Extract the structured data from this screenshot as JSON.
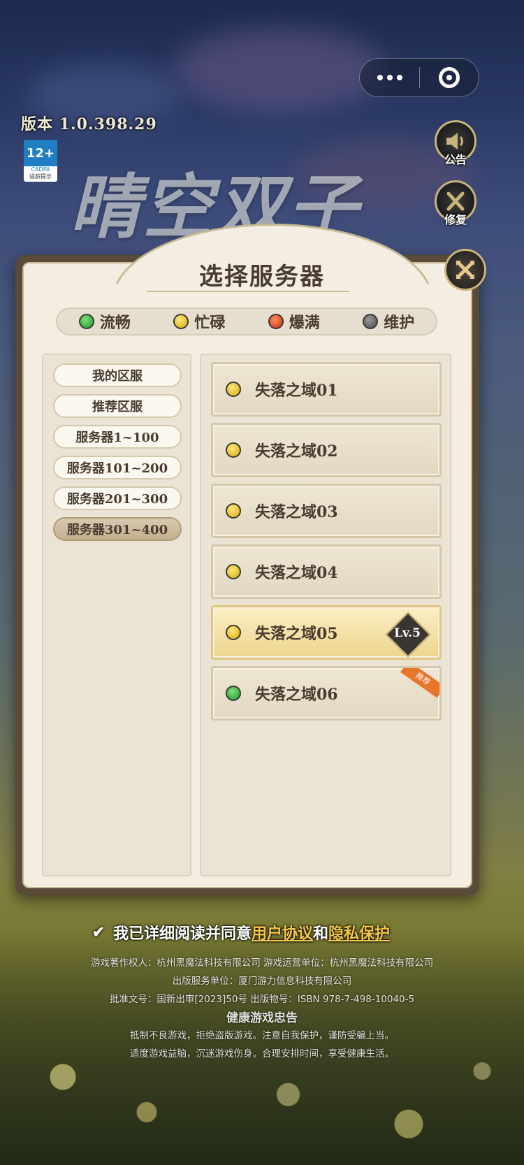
{
  "header": {
    "version_label": "版本 1.0.398.29",
    "age_rating": {
      "badge": "12+",
      "org": "CADPA",
      "caption": "适龄提示"
    },
    "game_logo_text": "晴空双子",
    "more_icon": "more-dots-icon",
    "target_icon": "close-miniprogram-icon"
  },
  "side_buttons": [
    {
      "label": "公告",
      "icon": "speaker-icon"
    },
    {
      "label": "修复",
      "icon": "wrench-icon"
    }
  ],
  "panel": {
    "title": "选择服务器",
    "close_icon": "close-x-icon",
    "legend": [
      {
        "label": "流畅",
        "color": "#22a83a"
      },
      {
        "label": "忙碌",
        "color": "#e0b311"
      },
      {
        "label": "爆满",
        "color": "#d23a12"
      },
      {
        "label": "维护",
        "color": "#5a5a5a"
      }
    ],
    "categories": [
      {
        "label": "我的区服",
        "active": false
      },
      {
        "label": "推荐区服",
        "active": false
      },
      {
        "label": "服务器1~100",
        "active": false
      },
      {
        "label": "服务器101~200",
        "active": false
      },
      {
        "label": "服务器201~300",
        "active": false
      },
      {
        "label": "服务器301~400",
        "active": true
      }
    ],
    "servers": [
      {
        "name": "失落之域01",
        "status": "忙碌"
      },
      {
        "name": "失落之域02",
        "status": "忙碌"
      },
      {
        "name": "失落之域03",
        "status": "忙碌"
      },
      {
        "name": "失落之域04",
        "status": "忙碌"
      },
      {
        "name": "失落之域05",
        "status": "忙碌",
        "selected": true,
        "level": "Lv.5"
      },
      {
        "name": "失落之域06",
        "status": "流畅",
        "tag": "推荐"
      }
    ]
  },
  "footer": {
    "agree_prefix": "我已详细阅读并同意",
    "agree_link1": "用户协议",
    "agree_and": "和",
    "agree_link2": "隐私保护",
    "copyright_line1": "游戏著作权人：杭州黑魔法科技有限公司  游戏运营单位：杭州黑魔法科技有限公司",
    "copyright_line2": "出版服务单位：厦门游力信息科技有限公司",
    "copyright_line3": "批准文号：国新出审[2023]50号  出版物号：ISBN 978-7-498-10040-5",
    "health_title": "健康游戏忠告",
    "health_line1": "抵制不良游戏，拒绝盗版游戏。注意自我保护，谨防受骗上当。",
    "health_line2": "适度游戏益脑，沉迷游戏伤身。合理安排时间，享受健康生活。"
  }
}
